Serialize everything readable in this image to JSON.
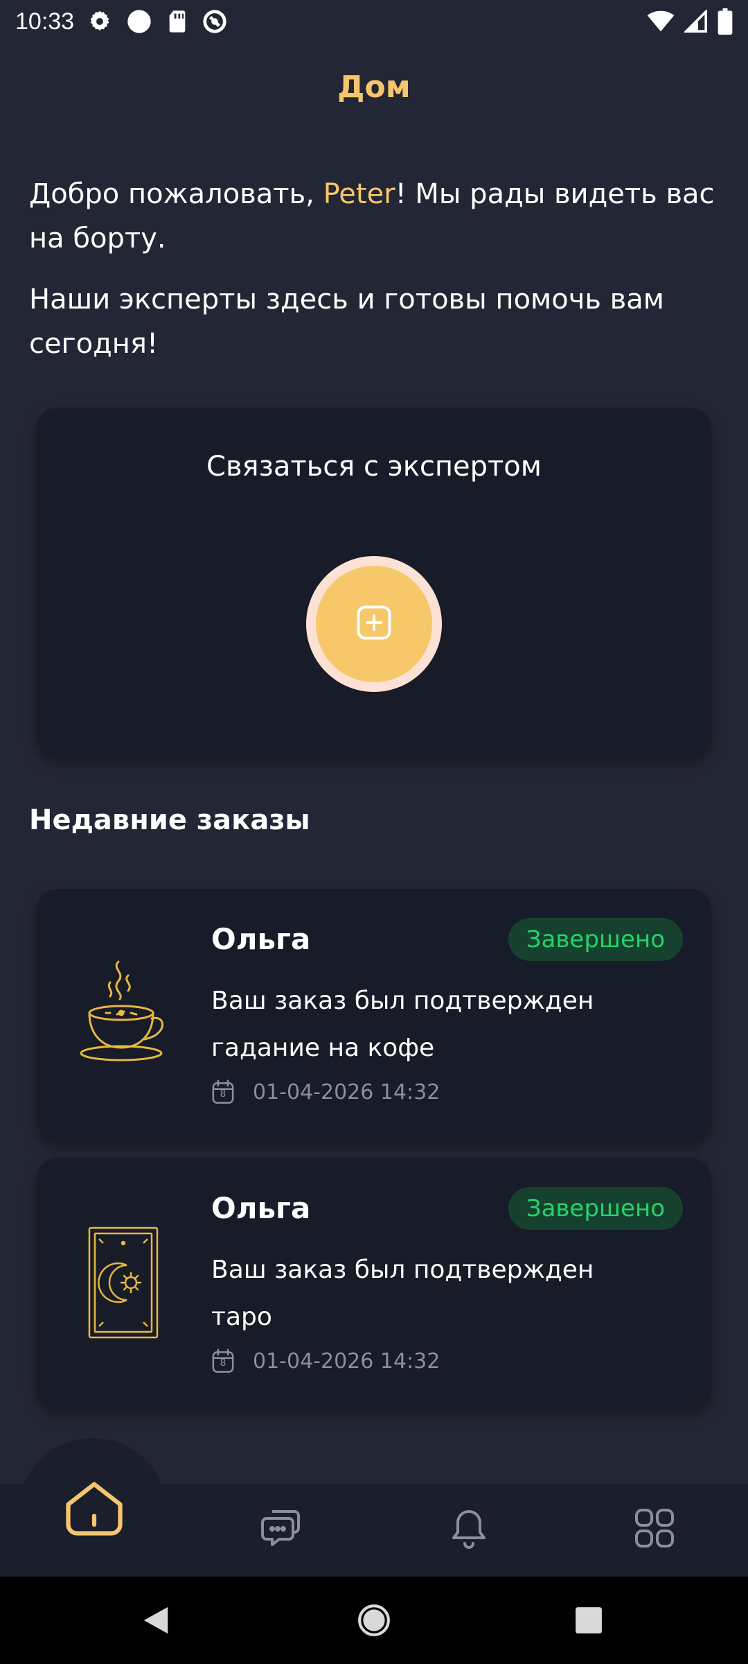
{
  "status_bar": {
    "time": "10:33",
    "icons": [
      "gear-icon",
      "circle-icon",
      "sd-card-icon",
      "do-not-disturb-icon",
      "wifi-icon",
      "signal-icon",
      "battery-icon"
    ]
  },
  "page": {
    "title": "Дом"
  },
  "welcome": {
    "prefix": "Добро пожаловать, ",
    "user_name": "Peter",
    "suffix": "! Мы рады видеть вас на борту.",
    "line2": "Наши эксперты здесь и готовы помочь вам сегодня!"
  },
  "contact": {
    "title": "Связаться с экспертом",
    "button_icon": "plus-square-icon"
  },
  "recent_orders": {
    "title": "Недавние заказы",
    "items": [
      {
        "name": "Ольга",
        "status": "Завершено",
        "line1": "Ваш заказ был подтвержден",
        "line2": "гадание на кофе",
        "date": "01-04-2026 14:32",
        "calendar_day": "8",
        "image": "coffee-cup-icon"
      },
      {
        "name": "Ольга",
        "status": "Завершено",
        "line1": "Ваш заказ был подтвержден",
        "line2": "таро",
        "date": "01-04-2026 14:32",
        "calendar_day": "8",
        "image": "tarot-card-icon"
      }
    ]
  },
  "bottom_nav": {
    "items": [
      "home-icon",
      "chat-icon",
      "bell-icon",
      "grid-icon"
    ],
    "active": "home-icon"
  },
  "colors": {
    "background": "#232634",
    "card": "#181b28",
    "accent": "#F6C56C",
    "status_bg": "#17412F",
    "status_text": "#22D46A"
  }
}
